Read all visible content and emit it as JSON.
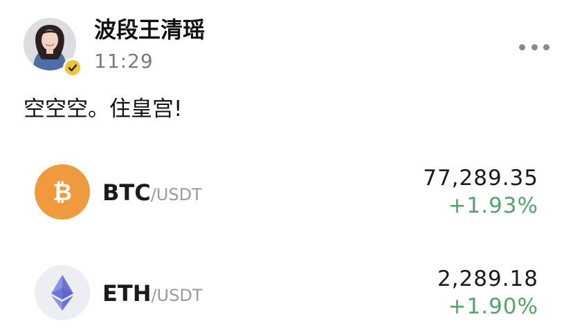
{
  "post": {
    "author": "波段王清瑶",
    "time": "11:29",
    "text": "空空空。住皇宫!",
    "verified": true
  },
  "icons": {
    "avatar": "avatar-photo",
    "badge": "verified-check-icon",
    "more": "more-dots-icon",
    "btc": "bitcoin-icon",
    "eth": "ethereum-icon"
  },
  "tickers": [
    {
      "base": "BTC",
      "quote": "/USDT",
      "price": "77,289.35",
      "change": "+1.93%"
    },
    {
      "base": "ETH",
      "quote": "/USDT",
      "price": "2,289.18",
      "change": "+1.90%"
    }
  ],
  "colors": {
    "positive": "#53a36b",
    "btc": "#ef9a3f",
    "badge": "#f2c23a"
  }
}
